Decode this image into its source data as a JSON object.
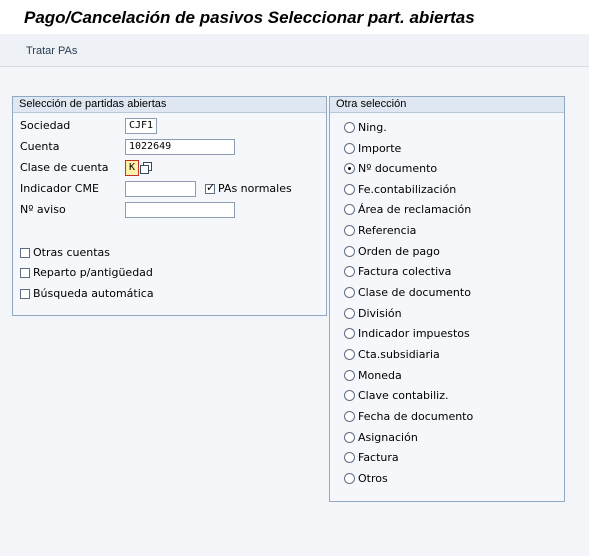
{
  "window": {
    "title": "Pago/Cancelación de pasivos Seleccionar part. abiertas"
  },
  "toolbar": {
    "process_label": "Tratar PAs"
  },
  "open_items": {
    "header": "Selección de partidas abiertas",
    "sociedad": {
      "label": "Sociedad",
      "value": "CJF1"
    },
    "cuenta": {
      "label": "Cuenta",
      "value": "1022649"
    },
    "clase_cuenta": {
      "label": "Clase de cuenta",
      "value": "K"
    },
    "indicador_cme": {
      "label": "Indicador CME",
      "value": ""
    },
    "pas_normales": {
      "label": "PAs normales",
      "checked": true
    },
    "n_aviso": {
      "label": "Nº aviso",
      "value": ""
    },
    "checkboxes": [
      {
        "label": "Otras cuentas",
        "checked": false
      },
      {
        "label": "Reparto p/antigüedad",
        "checked": false
      },
      {
        "label": "Búsqueda automática",
        "checked": false
      }
    ]
  },
  "other_selection": {
    "header": "Otra selección",
    "options": [
      {
        "label": "Ning.",
        "selected": false
      },
      {
        "label": "Importe",
        "selected": false
      },
      {
        "label": "Nº documento",
        "selected": true
      },
      {
        "label": "Fe.contabilización",
        "selected": false
      },
      {
        "label": "Área de reclamación",
        "selected": false
      },
      {
        "label": "Referencia",
        "selected": false
      },
      {
        "label": "Orden de pago",
        "selected": false
      },
      {
        "label": "Factura colectiva",
        "selected": false
      },
      {
        "label": "Clase de documento",
        "selected": false
      },
      {
        "label": "División",
        "selected": false
      },
      {
        "label": "Indicador impuestos",
        "selected": false
      },
      {
        "label": "Cta.subsidiaria",
        "selected": false
      },
      {
        "label": "Moneda",
        "selected": false
      },
      {
        "label": "Clave contabiliz.",
        "selected": false
      },
      {
        "label": "Fecha de documento",
        "selected": false
      },
      {
        "label": "Asignación",
        "selected": false
      },
      {
        "label": "Factura",
        "selected": false
      },
      {
        "label": "Otros",
        "selected": false
      }
    ]
  }
}
